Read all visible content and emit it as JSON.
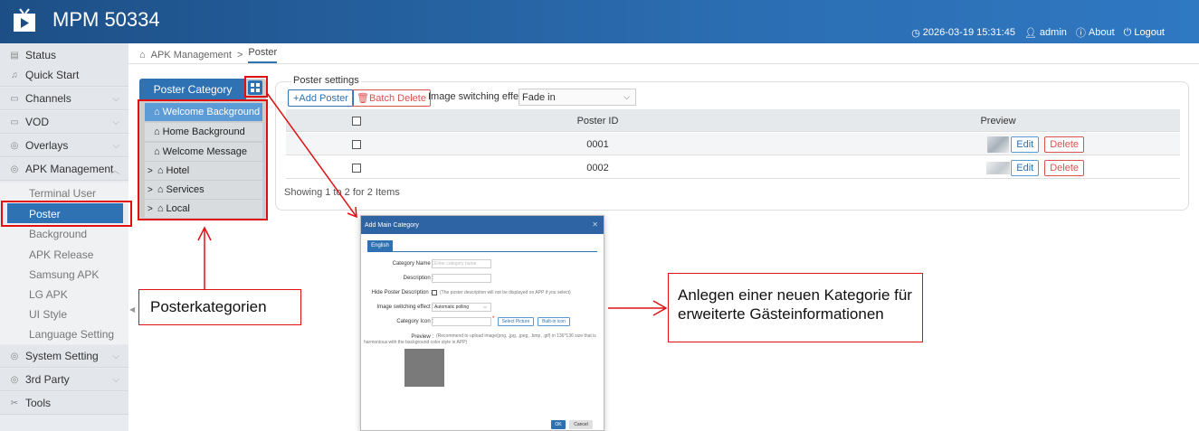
{
  "header": {
    "title": "MPM 50334",
    "datetime": "2026-03-19 15:31:45",
    "user": "admin",
    "about": "About",
    "logout": "Logout"
  },
  "sidebar": {
    "items": [
      {
        "label": "Status",
        "icon": "status-icon"
      },
      {
        "label": "Quick Start",
        "icon": "bell-icon"
      },
      {
        "label": "Channels",
        "icon": "channels-icon"
      },
      {
        "label": "VOD",
        "icon": "vod-icon"
      },
      {
        "label": "Overlays",
        "icon": "overlays-icon"
      },
      {
        "label": "APK Management",
        "icon": "apk-icon"
      }
    ],
    "subitems": [
      "Terminal User",
      "Poster",
      "Background",
      "APK Release",
      "Samsung APK",
      "LG APK",
      "UI Style",
      "Language Setting"
    ],
    "bottom": [
      {
        "label": "System Setting",
        "icon": "system-icon"
      },
      {
        "label": "3rd Party",
        "icon": "thirdparty-icon"
      },
      {
        "label": "Tools",
        "icon": "tools-icon"
      }
    ]
  },
  "breadcrumb": {
    "parent": "APK Management",
    "separator": ">",
    "current": "Poster"
  },
  "category": {
    "header": "Poster Category",
    "items": [
      {
        "label": "Welcome Background",
        "expandable": false
      },
      {
        "label": "Home Background",
        "expandable": false
      },
      {
        "label": "Welcome Message",
        "expandable": false
      },
      {
        "label": "Hotel",
        "expandable": true
      },
      {
        "label": "Services",
        "expandable": true
      },
      {
        "label": "Local",
        "expandable": true
      }
    ]
  },
  "poster": {
    "section_title": "Poster settings",
    "add_label": "+Add Poster",
    "batch_delete_label": "Batch Delete",
    "effect_label": "Image switching effect:",
    "effect_value": "Fade in",
    "columns": [
      "",
      "Poster ID",
      "Preview",
      ""
    ],
    "rows": [
      {
        "id": "0001",
        "edit": "Edit",
        "delete": "Delete"
      },
      {
        "id": "0002",
        "edit": "Edit",
        "delete": "Delete"
      }
    ],
    "showing": "Showing 1 to 2 for 2 Items"
  },
  "dialog": {
    "title": "Add Main Category",
    "tab": "English",
    "category_name_label": "Category Name :",
    "category_name_placeholder": "Enter category name",
    "description_label": "Description :",
    "hide_label": "Hide Poster Description :",
    "hide_note": "(The poster description will not be displayed on APP if you select)",
    "effect_label": "Image switching effect :",
    "effect_value": "Automatic polling",
    "icon_label": "Category Icon :",
    "select_picture": "Select Picture",
    "built_in_icon": "Built-in icon",
    "preview_label": "Preview :",
    "preview_note": "(Recommend to upload image(png, .jpg, .jpeg, .bmp, .gif) in 136*136 size that is harmonious with the background color style in APP)",
    "ok": "OK",
    "cancel": "Cancel"
  },
  "annotations": {
    "left": "Posterkategorien",
    "right_line1": "Anlegen einer neuen Kategorie für",
    "right_line2": "erweiterte Gästeinformationen"
  },
  "colors": {
    "header_blue": "#2b6db1",
    "accent": "#2e72b3",
    "danger": "#d9534f",
    "annotation_red": "#e01010"
  }
}
